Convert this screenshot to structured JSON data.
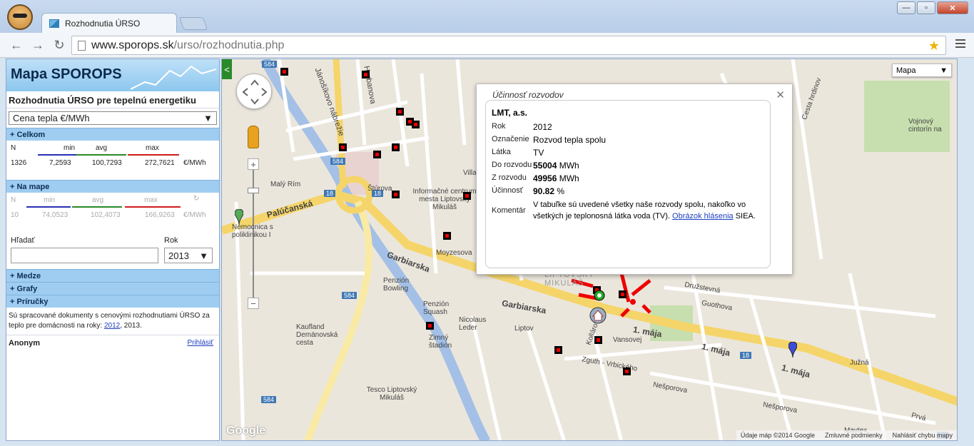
{
  "browser": {
    "tab_title": "Rozhodnutia ÚRSO",
    "url_host": "www.sporops.sk",
    "url_path": "/urso/rozhodnutia.php"
  },
  "panel": {
    "title": "Mapa SPOROPS",
    "subtitle": "Rozhodnutia ÚRSO pre tepelnú energetiku",
    "metric_select": "Cena tepla €/MWh",
    "sections": {
      "celkom": "+ Celkom",
      "na_mape": "+ Na mape",
      "medze": "+ Medze",
      "grafy": "+ Grafy",
      "prirucky": "+ Príručky"
    },
    "stats_headers": {
      "n": "N",
      "min": "min",
      "avg": "avg",
      "max": "max"
    },
    "celkom": {
      "n": "1326",
      "min": "7,2593",
      "avg": "100,7293",
      "max": "272,7621",
      "unit": "€/MWh"
    },
    "na_mape": {
      "n": "10",
      "min": "74,0523",
      "avg": "102,4073",
      "max": "166,9263",
      "unit": "€/MWh"
    },
    "search_label": "Hľadať",
    "year_label": "Rok",
    "year_value": "2013",
    "info_prefix": "Sú spracované dokumenty s cenovými rozhodnutiami ÚRSO za teplo pre domácnosti na roky: ",
    "info_link": "2012",
    "info_suffix": ", 2013.",
    "user": "Anonym",
    "login": "Prihlásiť",
    "colors": {
      "min": "#2a2fb5",
      "avg": "#2a8a2a",
      "max": "#d11a1a"
    }
  },
  "map": {
    "type_select": "Mapa",
    "labels": {
      "palucanska": "Palúčanská",
      "garbiarska": "Garbiarska",
      "garbiarska2": "Garbiarska",
      "maja1": "1. mája",
      "maja2": "1. mája",
      "maja3": "1. mája",
      "janoskovo": "Jánošíkovo nábrežie",
      "hurbanova": "Hurbanova",
      "nemocnica": "Nemocnica s poliklinikou I",
      "informacne": "Informačné centrum mesta Liptovský Mikuláš",
      "penzion_bowling": "Penzión Bowling",
      "penzion_squash": "Penzión Squash",
      "nicolaus": "Nicolaus Leder",
      "zimny": "Zimný štadión",
      "kaufland": "Kaufland Demänovská cesta",
      "tesco": "Tesco Liptovský Mikuláš",
      "maly_rim": "Malý Rím",
      "sturova": "Štúrova",
      "moyzesova": "Moyzesova",
      "liptov": "Liptov",
      "vansovej": "Vansovej",
      "druzstevna": "Družstevná",
      "guothova": "Guothova",
      "nesporova": "Nešporova",
      "nesporova2": "Nešporova",
      "maytex": "Maytex",
      "juzna": "Južná",
      "vojnovy": "Vojnový cintorín na",
      "cesta_hrdinov": "Cesta hrdinov",
      "liptovsky_mikulas": "LIPTOVSKÝ MIKULÁŠ",
      "vila": "Villa",
      "kolarova": "Kollárova",
      "zguth": "Zguth - Vrbického",
      "pri": "Prvá"
    },
    "road_numbers": [
      "584",
      "584",
      "18",
      "18",
      "584",
      "584",
      "18",
      "18"
    ],
    "footer": {
      "data": "Údaje máp ©2014 Google",
      "terms": "Zmluvné podmienky",
      "report": "Nahlásiť chybu mapy"
    },
    "google": "Google"
  },
  "infowindow": {
    "title": "Účinnosť rozvodov",
    "company": "LMT, a.s.",
    "labels": {
      "rok": "Rok",
      "oznacenie": "Označenie",
      "latka": "Látka",
      "do_rozvodu": "Do rozvodu",
      "z_rozvodu": "Z rozvodu",
      "ucinnost": "Účinnosť",
      "komentar": "Komentár"
    },
    "values": {
      "rok": "2012",
      "oznacenie": "Rozvod tepla spolu",
      "latka": "TV",
      "do_rozvodu_num": "55004",
      "do_rozvodu_unit": " MWh",
      "z_rozvodu_num": "49956",
      "z_rozvodu_unit": " MWh",
      "ucinnost_num": "90.82",
      "ucinnost_unit": " %",
      "komentar_text": "V tabuľke sú uvedené všetky naše rozvody spolu, nakoľko vo všetkých je teplonosná látka voda (TV). ",
      "komentar_link": "Obrázok hlásenia",
      "komentar_tail": " SIEA."
    }
  }
}
